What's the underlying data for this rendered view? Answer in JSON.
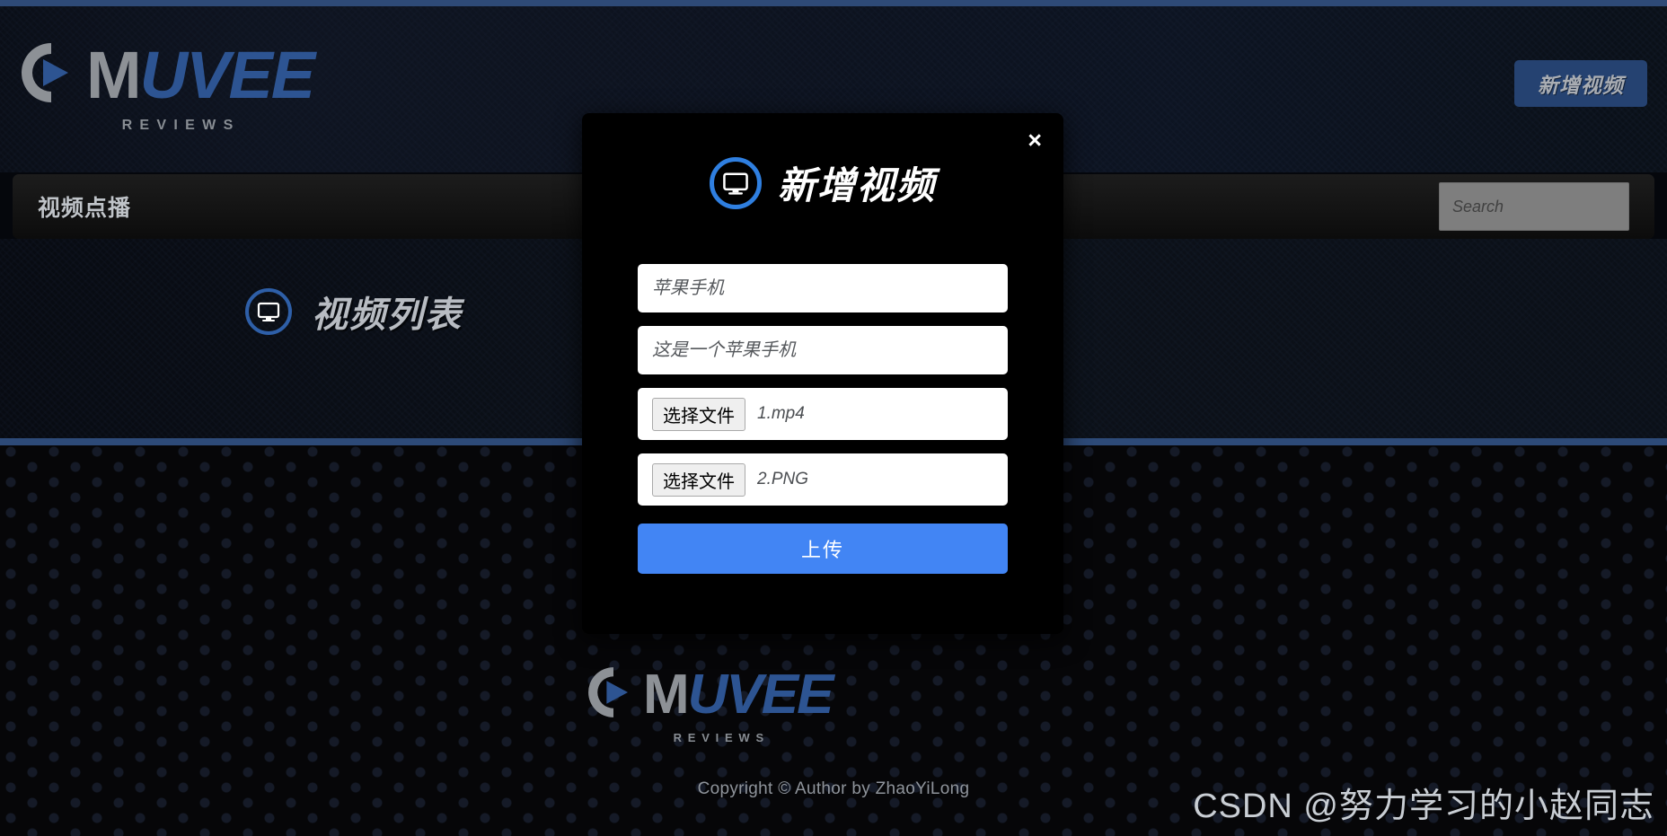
{
  "header": {
    "logo": {
      "icon": "play-circle-icon",
      "word_gray": "M",
      "word_blue": "UVEE",
      "subtitle": "REVIEWS"
    },
    "add_video_button": "新增视频"
  },
  "navbar": {
    "title": "视频点播",
    "search": {
      "placeholder": "Search",
      "value": ""
    }
  },
  "main": {
    "section_title": "视频列表",
    "section_icon": "monitor-icon"
  },
  "footer": {
    "logo": {
      "icon": "play-circle-icon",
      "word_gray": "M",
      "word_blue": "UVEE",
      "subtitle": "REVIEWS"
    },
    "copyright": "Copyright © Author by ZhaoYiLong"
  },
  "watermark": {
    "text": "CSDN @努力学习的小赵同志"
  },
  "modal": {
    "title": "新增视频",
    "icon": "monitor-icon",
    "close_label": "×",
    "fields": {
      "name": {
        "placeholder": "苹果手机",
        "value": "苹果手机"
      },
      "description": {
        "placeholder": "这是一个苹果手机",
        "value": "这是一个苹果手机"
      },
      "video_file": {
        "button_label": "选择文件",
        "file_name": "1.mp4"
      },
      "cover_file": {
        "button_label": "选择文件",
        "file_name": "2.PNG"
      }
    },
    "submit_label": "上传"
  },
  "colors": {
    "accent_blue": "#2d4a78",
    "primary_blue": "#4285f4",
    "logo_blue": "#2d5492",
    "logo_gray": "#8d9196",
    "button_navy": "#254271"
  }
}
